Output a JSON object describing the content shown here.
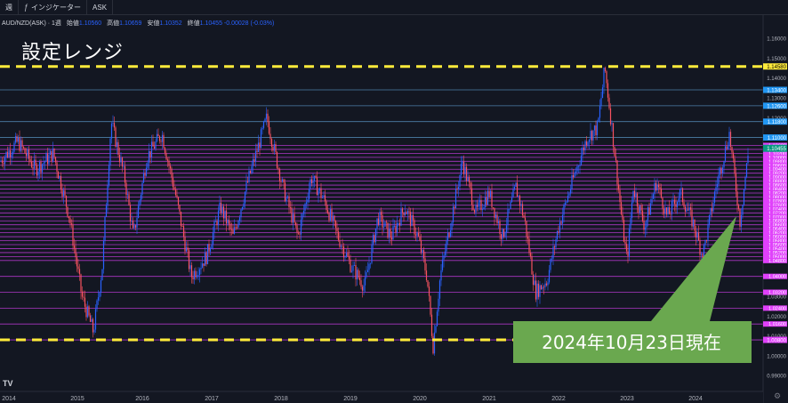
{
  "toolbar": {
    "interval": "週",
    "indicators_label": "インジケーター",
    "price_type": "ASK"
  },
  "legend": {
    "symbol": "AUD/NZD(ASK) · 1週",
    "open_label": "始値",
    "open": "1.10560",
    "high_label": "高値",
    "high": "1.10659",
    "low_label": "安値",
    "low": "1.10352",
    "close_label": "終値",
    "close": "1.10455",
    "change": "-0.00028 (-0.03%)"
  },
  "overlay_title": "設定レンジ",
  "callout_text": "2024年10月23日現在",
  "chart_data": {
    "type": "candlestick",
    "x_axis_years": [
      "2014",
      "2015",
      "2016",
      "2017",
      "2018",
      "2019",
      "2020",
      "2021",
      "2022",
      "2023",
      "2024"
    ],
    "y_ticks": [
      "1.16000",
      "1.15000",
      "1.14000",
      "1.13000",
      "1.12000",
      "1.11000",
      "1.10000",
      "1.09000",
      "1.08000",
      "1.07000",
      "1.06000",
      "1.05000",
      "1.04000",
      "1.03000",
      "1.02000",
      "1.01000",
      "1.00000",
      "0.99000"
    ],
    "ylim": [
      0.9865,
      1.1645
    ],
    "current_price": "1.10455",
    "range_top": "1.14580",
    "range_bottom": "1.00800",
    "blue_levels": [
      "1.13400",
      "1.12600",
      "1.11800",
      "1.11000"
    ],
    "magenta_levels": [
      "1.10600",
      "1.10400",
      "1.10200",
      "1.10000",
      "1.09800",
      "1.09600",
      "1.09400",
      "1.09200",
      "1.09000",
      "1.08800",
      "1.08600",
      "1.08400",
      "1.08200",
      "1.08000",
      "1.07800",
      "1.07600",
      "1.07400",
      "1.07200",
      "1.07000",
      "1.06800",
      "1.06600",
      "1.06400",
      "1.06200",
      "1.06000",
      "1.05800",
      "1.05600",
      "1.05400",
      "1.05200",
      "1.05000",
      "1.04800",
      "1.04000",
      "1.03200",
      "1.02400",
      "1.01600",
      "1.00800"
    ],
    "colors": {
      "up": "#26a69a",
      "down": "#ef5350",
      "candle_down": "#f7525f",
      "candle_up": "#2962ff",
      "magenta": "#e040fb",
      "blue": "#2196f3",
      "range": "#ffeb3b",
      "callout": "#6aa84f"
    }
  }
}
